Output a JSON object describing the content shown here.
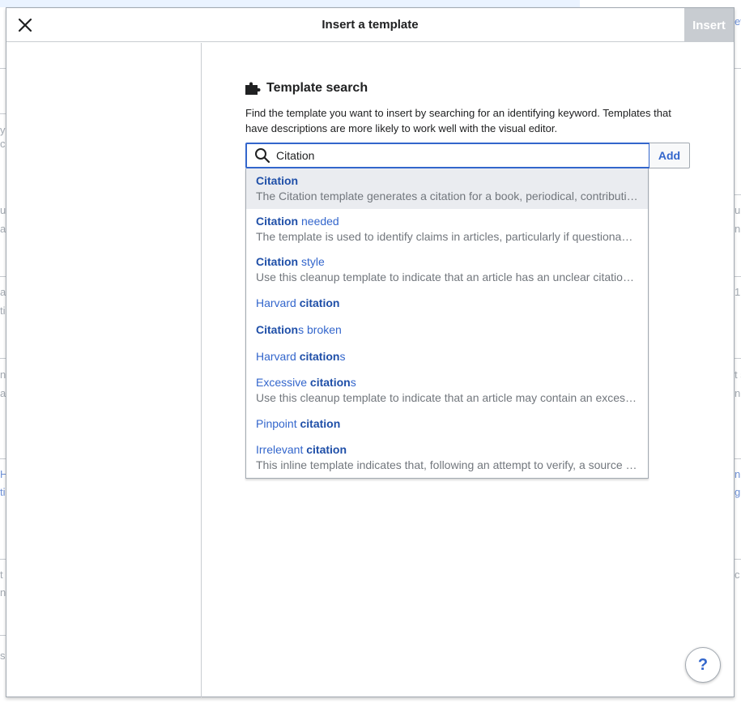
{
  "background": {
    "fragments_left": [
      "y",
      "c",
      "u",
      "a",
      "a",
      "ti",
      "n",
      "a",
      "H",
      "ti",
      "t",
      "n",
      "s"
    ],
    "fragments_right": [
      "ev",
      "u",
      "n",
      "1",
      "t s",
      "n",
      "n",
      "gl",
      "c"
    ]
  },
  "dialog": {
    "title": "Insert a template",
    "insert_label": "Insert"
  },
  "search": {
    "heading": "Template search",
    "description": "Find the template you want to insert by searching for an identifying keyword. Templates that have descriptions are more likely to work well with the visual editor.",
    "value": "Citation",
    "placeholder": "",
    "add_label": "Add"
  },
  "suggestions": [
    {
      "pre": "",
      "match": "Citation",
      "post": "",
      "desc": "The Citation template generates a citation for a book, periodical, contribution in a collective work, or a web page."
    },
    {
      "pre": "",
      "match": "Citation",
      "post": " needed",
      "desc": "The template is used to identify claims in articles, particularly if questionable, that need a citation."
    },
    {
      "pre": "",
      "match": "Citation",
      "post": " style",
      "desc": "Use this cleanup template to indicate that an article has an unclear citation style."
    },
    {
      "pre": "Harvard ",
      "match": "citation",
      "post": "",
      "desc": ""
    },
    {
      "pre": "",
      "match": "Citation",
      "post": "s broken",
      "desc": ""
    },
    {
      "pre": "Harvard ",
      "match": "citation",
      "post": "s",
      "desc": ""
    },
    {
      "pre": "Excessive ",
      "match": "citation",
      "post": "s",
      "desc": "Use this cleanup template to indicate that an article may contain an excessive number of citations."
    },
    {
      "pre": "Pinpoint ",
      "match": "citation",
      "post": "",
      "desc": ""
    },
    {
      "pre": "Irrelevant ",
      "match": "citation",
      "post": "",
      "desc": "This inline template indicates that, following an attempt to verify, a source does not support the claim."
    }
  ],
  "help_label": "?",
  "colors": {
    "accent": "#3366cc",
    "disabled": "#c8ccd1",
    "border": "#a2a9b1",
    "highlight": "#eaecf0"
  },
  "icons": {
    "close": "close-icon",
    "puzzle": "puzzle-icon",
    "search": "search-icon"
  }
}
